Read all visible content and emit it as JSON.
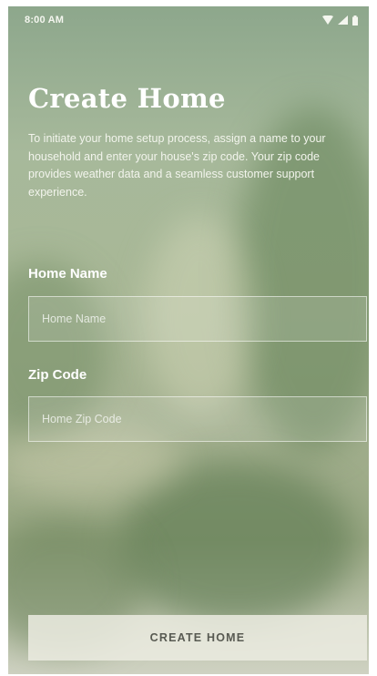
{
  "status_bar": {
    "time": "8:00 AM",
    "icons": [
      "wifi-icon",
      "signal-icon",
      "battery-icon"
    ]
  },
  "page": {
    "title": "Create Home",
    "description": "To initiate your home setup process, assign a name to your household and enter your house's zip code. Your zip code provides weather data and a seamless customer support experience."
  },
  "form": {
    "home_name": {
      "label": "Home Name",
      "placeholder": "Home Name",
      "value": ""
    },
    "zip_code": {
      "label": "Zip Code",
      "placeholder": "Home Zip Code",
      "value": ""
    }
  },
  "actions": {
    "create_label": "CREATE HOME"
  },
  "colors": {
    "text": "#ffffff",
    "button_bg": "#ebebe1",
    "button_text": "#585a52"
  }
}
